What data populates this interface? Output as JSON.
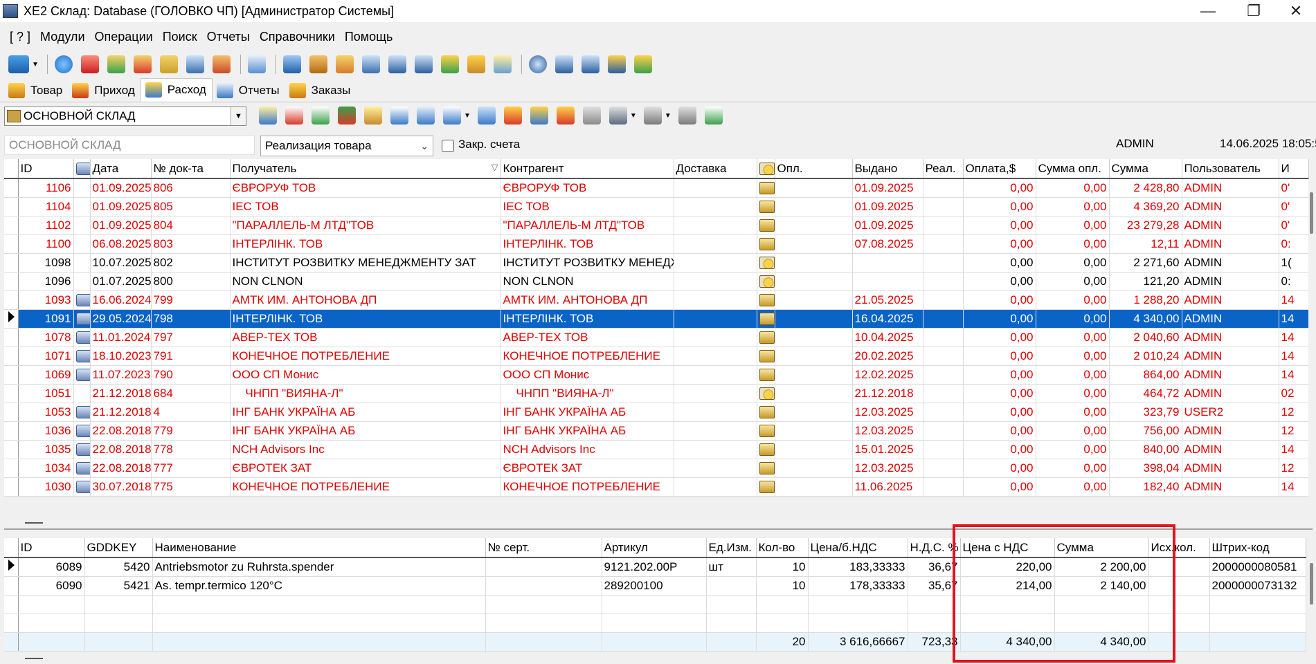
{
  "window": {
    "title": "XE2  Склад: Database (ГОЛОВКО ЧП) [Администратор Системы]",
    "minimize": "—",
    "maximize": "❐",
    "close": "✕"
  },
  "menu": [
    "[ ? ]",
    "Модули",
    "Операции",
    "Поиск",
    "Отчеты",
    "Справочники",
    "Помощь"
  ],
  "tabs": [
    "Товар",
    "Приход",
    "Расход",
    "Отчеты",
    "Заказы"
  ],
  "warehouse_select": "ОСНОВНОЙ СКЛАД",
  "filter": {
    "warehouse_text": "ОСНОВНОЙ СКЛАД",
    "operation": "Реализация товара",
    "closed_accounts_label": "Закр. счета",
    "closed_accounts_checked": false,
    "user": "ADMIN",
    "datetime": "14.06.2025 18:05:5"
  },
  "main_table": {
    "columns": [
      "ID",
      "",
      "Дата",
      "№ док-та",
      "Получатель",
      "Контрагент",
      "Доставка",
      "",
      "Опл.",
      "Выдано",
      "Реал.",
      "Оплата,$",
      "Сумма опл.",
      "Сумма",
      "Пользователь",
      "И"
    ],
    "rows": [
      {
        "id": "1106",
        "print": false,
        "date": "01.09.2025",
        "doc": "806",
        "recipient": "ЄВРОРУФ ТОВ",
        "contractor": "ЄВРОРУФ ТОВ",
        "delivery": "",
        "pay_icon": "invoice",
        "opl": "",
        "issued": "01.09.2025",
        "real": "",
        "pay_usd": "0,00",
        "paid_sum": "0,00",
        "sum": "2 428,80",
        "user": "ADMIN",
        "extra": "0'",
        "color": "red"
      },
      {
        "id": "1104",
        "print": false,
        "date": "01.09.2025",
        "doc": "805",
        "recipient": "IEC ТОВ",
        "contractor": "IEC ТОВ",
        "delivery": "",
        "pay_icon": "invoice",
        "opl": "",
        "issued": "01.09.2025",
        "real": "",
        "pay_usd": "0,00",
        "paid_sum": "0,00",
        "sum": "4 369,20",
        "user": "ADMIN",
        "extra": "0'",
        "color": "red"
      },
      {
        "id": "1102",
        "print": false,
        "date": "01.09.2025",
        "doc": "804",
        "recipient": "\"ПАРАЛЛЕЛЬ-М ЛТД\"ТОВ",
        "contractor": "\"ПАРАЛЛЕЛЬ-М ЛТД\"ТОВ",
        "delivery": "",
        "pay_icon": "invoice",
        "opl": "",
        "issued": "01.09.2025",
        "real": "",
        "pay_usd": "0,00",
        "paid_sum": "0,00",
        "sum": "23 279,28",
        "user": "ADMIN",
        "extra": "0'",
        "color": "red"
      },
      {
        "id": "1100",
        "print": false,
        "date": "06.08.2025",
        "doc": "803",
        "recipient": "ІНТЕРЛІНК. ТОВ",
        "contractor": "ІНТЕРЛІНК. ТОВ",
        "delivery": "",
        "pay_icon": "invoice",
        "opl": "",
        "issued": "07.08.2025",
        "real": "",
        "pay_usd": "0,00",
        "paid_sum": "0,00",
        "sum": "12,11",
        "user": "ADMIN",
        "extra": "0:",
        "color": "red"
      },
      {
        "id": "1098",
        "print": false,
        "date": "10.07.2025",
        "doc": "802",
        "recipient": "ІНСТИТУТ РОЗВИТКУ МЕНЕДЖМЕНТУ ЗАТ",
        "contractor": "ІНСТИТУТ РОЗВИТКУ МЕНЕДЖ",
        "delivery": "",
        "pay_icon": "coin",
        "opl": "",
        "issued": "",
        "real": "",
        "pay_usd": "0,00",
        "paid_sum": "0,00",
        "sum": "2 271,60",
        "user": "ADMIN",
        "extra": "1(",
        "color": "black"
      },
      {
        "id": "1096",
        "print": false,
        "date": "01.07.2025",
        "doc": "800",
        "recipient": "NON CLNON",
        "contractor": "NON CLNON",
        "delivery": "",
        "pay_icon": "coin",
        "opl": "",
        "issued": "",
        "real": "",
        "pay_usd": "0,00",
        "paid_sum": "0,00",
        "sum": "121,20",
        "user": "ADMIN",
        "extra": "0:",
        "color": "black"
      },
      {
        "id": "1093",
        "print": true,
        "date": "16.06.2024",
        "doc": "799",
        "recipient": "АМТК ИМ. АНТОНОВА ДП",
        "contractor": "АМТК ИМ. АНТОНОВА ДП",
        "delivery": "",
        "pay_icon": "invoice",
        "opl": "",
        "issued": "21.05.2025",
        "real": "",
        "pay_usd": "0,00",
        "paid_sum": "0,00",
        "sum": "1 288,20",
        "user": "ADMIN",
        "extra": "14",
        "color": "red"
      },
      {
        "id": "1091",
        "print": true,
        "date": "29.05.2024",
        "doc": "798",
        "recipient": "ІНТЕРЛІНК. ТОВ",
        "contractor": "ІНТЕРЛІНК. ТОВ",
        "delivery": "",
        "pay_icon": "invoice",
        "opl": "",
        "issued": "16.04.2025",
        "real": "",
        "pay_usd": "0,00",
        "paid_sum": "0,00",
        "sum": "4 340,00",
        "user": "ADMIN",
        "extra": "14",
        "color": "selected"
      },
      {
        "id": "1078",
        "print": true,
        "date": "11.01.2024",
        "doc": "797",
        "recipient": "АВЕР-ТЕХ ТОВ",
        "contractor": "АВЕР-ТЕХ ТОВ",
        "delivery": "",
        "pay_icon": "invoice",
        "opl": "",
        "issued": "10.04.2025",
        "real": "",
        "pay_usd": "0,00",
        "paid_sum": "0,00",
        "sum": "2 040,60",
        "user": "ADMIN",
        "extra": "14",
        "color": "red"
      },
      {
        "id": "1071",
        "print": true,
        "date": "18.10.2023",
        "doc": "791",
        "recipient": "КОНЕЧНОЕ ПОТРЕБЛЕНИЕ",
        "contractor": "КОНЕЧНОЕ ПОТРЕБЛЕНИЕ",
        "delivery": "",
        "pay_icon": "invoice",
        "opl": "",
        "issued": "20.02.2025",
        "real": "",
        "pay_usd": "0,00",
        "paid_sum": "0,00",
        "sum": "2 010,24",
        "user": "ADMIN",
        "extra": "14",
        "color": "red"
      },
      {
        "id": "1069",
        "print": true,
        "date": "11.07.2023",
        "doc": "790",
        "recipient": "ООО СП Монис",
        "contractor": "ООО СП Монис",
        "delivery": "",
        "pay_icon": "invoice",
        "opl": "",
        "issued": "12.02.2025",
        "real": "",
        "pay_usd": "0,00",
        "paid_sum": "0,00",
        "sum": "864,00",
        "user": "ADMIN",
        "extra": "14",
        "color": "red"
      },
      {
        "id": "1051",
        "print": false,
        "date": "21.12.2018",
        "doc": "684",
        "recipient": "    ЧНПП \"ВИЯНА-Л\"",
        "contractor": "    ЧНПП \"ВИЯНА-Л\"",
        "delivery": "",
        "pay_icon": "coin",
        "opl": "",
        "issued": "21.12.2018",
        "real": "",
        "pay_usd": "0,00",
        "paid_sum": "0,00",
        "sum": "464,72",
        "user": "ADMIN",
        "extra": "02",
        "color": "red"
      },
      {
        "id": "1053",
        "print": true,
        "date": "21.12.2018",
        "doc": "4",
        "recipient": "ІНГ БАНК УКРАЇНА АБ",
        "contractor": "ІНГ БАНК УКРАЇНА АБ",
        "delivery": "",
        "pay_icon": "invoice",
        "opl": "",
        "issued": "12.03.2025",
        "real": "",
        "pay_usd": "0,00",
        "paid_sum": "0,00",
        "sum": "323,79",
        "user": "USER2",
        "extra": "12",
        "color": "red"
      },
      {
        "id": "1036",
        "print": true,
        "date": "22.08.2018",
        "doc": "779",
        "recipient": "ІНГ БАНК УКРАЇНА АБ",
        "contractor": "ІНГ БАНК УКРАЇНА АБ",
        "delivery": "",
        "pay_icon": "invoice",
        "opl": "",
        "issued": "12.03.2025",
        "real": "",
        "pay_usd": "0,00",
        "paid_sum": "0,00",
        "sum": "756,00",
        "user": "ADMIN",
        "extra": "12",
        "color": "red"
      },
      {
        "id": "1035",
        "print": true,
        "date": "22.08.2018",
        "doc": "778",
        "recipient": "NCH Advisors Inc",
        "contractor": "NCH Advisors Inc",
        "delivery": "",
        "pay_icon": "invoice",
        "opl": "",
        "issued": "15.01.2025",
        "real": "",
        "pay_usd": "0,00",
        "paid_sum": "0,00",
        "sum": "840,00",
        "user": "ADMIN",
        "extra": "14",
        "color": "red"
      },
      {
        "id": "1034",
        "print": true,
        "date": "22.08.2018",
        "doc": "777",
        "recipient": "ЄВРОТЕК ЗАТ",
        "contractor": "ЄВРОТЕК ЗАТ",
        "delivery": "",
        "pay_icon": "invoice",
        "opl": "",
        "issued": "12.03.2025",
        "real": "",
        "pay_usd": "0,00",
        "paid_sum": "0,00",
        "sum": "398,04",
        "user": "ADMIN",
        "extra": "12",
        "color": "red"
      },
      {
        "id": "1030",
        "print": true,
        "date": "30.07.2018",
        "doc": "775",
        "recipient": "КОНЕЧНОЕ ПОТРЕБЛЕНИЕ",
        "contractor": "КОНЕЧНОЕ ПОТРЕБЛЕНИЕ",
        "delivery": "",
        "pay_icon": "invoice",
        "opl": "",
        "issued": "11.06.2025",
        "real": "",
        "pay_usd": "0,00",
        "paid_sum": "0,00",
        "sum": "182,40",
        "user": "ADMIN",
        "extra": "14",
        "color": "red"
      }
    ]
  },
  "detail_table": {
    "columns": [
      "ID",
      "GDDKEY",
      "Наименование",
      "№ серт.",
      "Артикул",
      "Ед.Изм.",
      "Кол-во",
      "Цена/б.НДС",
      "Н.Д.С. %",
      "Цена с НДС",
      "Сумма",
      "Исх.кол.",
      "Штрих-код"
    ],
    "rows": [
      {
        "id": "6089",
        "gddkey": "5420",
        "name": "Antriebsmotor zu Ruhrsta.spender",
        "cert": "",
        "article": "9121.202.00P",
        "unit": "шт",
        "qty": "10",
        "price_no_vat": "183,33333",
        "vat": "36,67",
        "price_vat": "220,00",
        "sum": "2 200,00",
        "orig_qty": "",
        "barcode": "2000000080581"
      },
      {
        "id": "6090",
        "gddkey": "5421",
        "name": "As. tempr.termico 120°C",
        "cert": "",
        "article": "289200100",
        "unit": "",
        "qty": "10",
        "price_no_vat": "178,33333",
        "vat": "35,67",
        "price_vat": "214,00",
        "sum": "2 140,00",
        "orig_qty": "",
        "barcode": "2000000073132"
      }
    ],
    "totals": {
      "qty": "20",
      "price_no_vat": "3 616,66667",
      "vat": "723,33",
      "price_vat": "4 340,00",
      "sum": "4 340,00"
    }
  },
  "colors": {
    "selection": "#0a64c8",
    "red_text": "#e00000",
    "highlight_box": "#e0141e",
    "totals_row": "#e8f4fb"
  }
}
